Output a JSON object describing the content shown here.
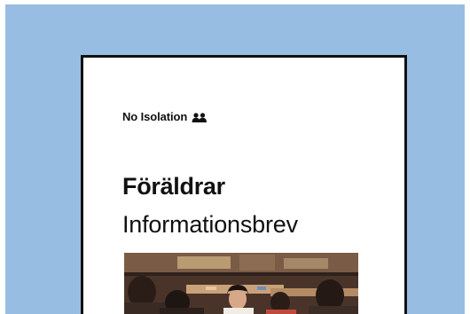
{
  "brand": {
    "name": "No Isolation",
    "icon": "two-people-icon"
  },
  "card": {
    "title": "Föräldrar",
    "subtitle": "Informationsbrev"
  },
  "photo": {
    "description_icon": "classroom-photo"
  },
  "colors": {
    "backdrop": "#98bde2",
    "card_border": "#111111",
    "text": "#111111"
  }
}
